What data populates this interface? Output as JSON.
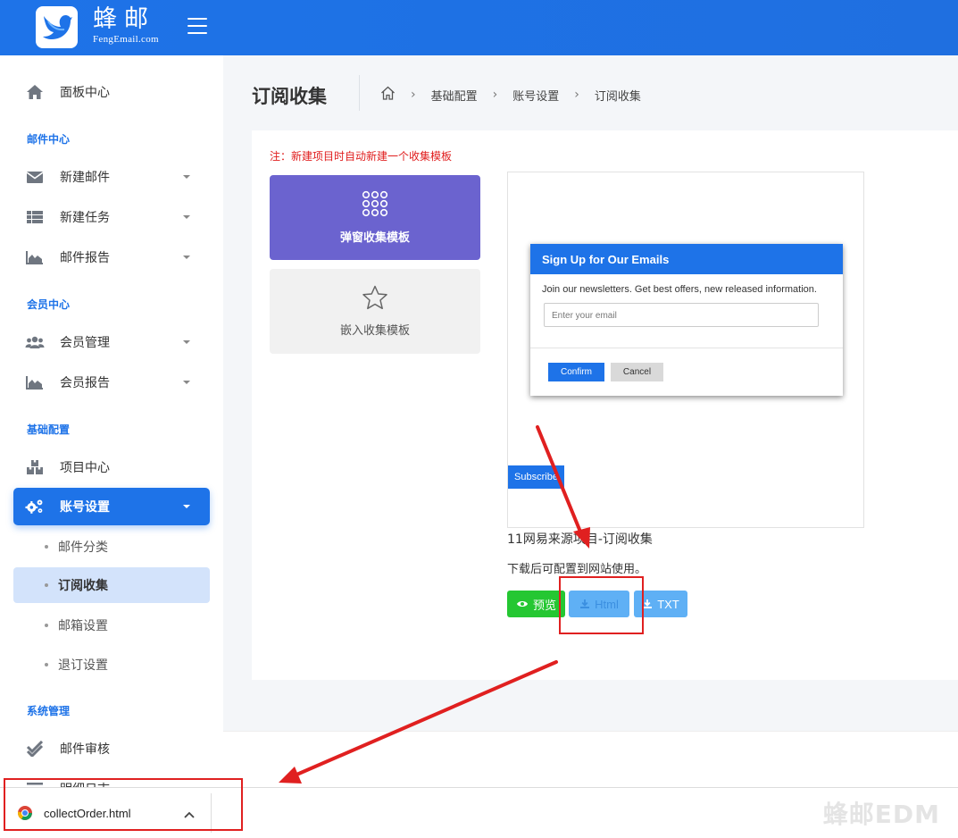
{
  "brand": {
    "name": "蜂邮",
    "sub": "FengEmail.com"
  },
  "sidebar": {
    "dashboard": "面板中心",
    "sections": {
      "mail": "邮件中心",
      "member": "会员中心",
      "config": "基础配置",
      "system": "系统管理"
    },
    "items": {
      "new_mail": "新建邮件",
      "new_task": "新建任务",
      "mail_report": "邮件报告",
      "member_manage": "会员管理",
      "member_report": "会员报告",
      "project_center": "项目中心",
      "account_settings": "账号设置",
      "mail_audit": "邮件审核",
      "detail_log": "明细日志"
    },
    "sub_items": {
      "mail_category": "邮件分类",
      "subscribe_collect": "订阅收集",
      "mailbox_settings": "邮箱设置",
      "unsubscribe_settings": "退订设置"
    }
  },
  "header": {
    "title": "订阅收集",
    "breadcrumb": [
      "基础配置",
      "账号设置",
      "订阅收集"
    ]
  },
  "content": {
    "note": "注：新建项目时自动新建一个收集模板",
    "templates": {
      "popup": "弹窗收集模板",
      "embed": "嵌入收集模板"
    },
    "popup_preview": {
      "heading": "Sign Up for Our Emails",
      "description": "Join our newsletters. Get best offers, new released information.",
      "email_placeholder": "Enter your email",
      "confirm": "Confirm",
      "cancel": "Cancel",
      "subscribe": "Subscribe"
    },
    "item_name": "11网易来源项目-订阅收集",
    "item_tip": "下载后可配置到网站使用。",
    "buttons": {
      "preview": "预览",
      "html": "Html",
      "txt": "TXT"
    }
  },
  "download_bar": {
    "file": "collectOrder.html"
  },
  "watermark": "蜂邮EDM",
  "colors": {
    "primary": "#1e73e8",
    "accent_purple": "#6b63cf",
    "preview_green": "#25c732",
    "download_blue": "#5fb0f5",
    "highlight_red": "#e02020"
  }
}
